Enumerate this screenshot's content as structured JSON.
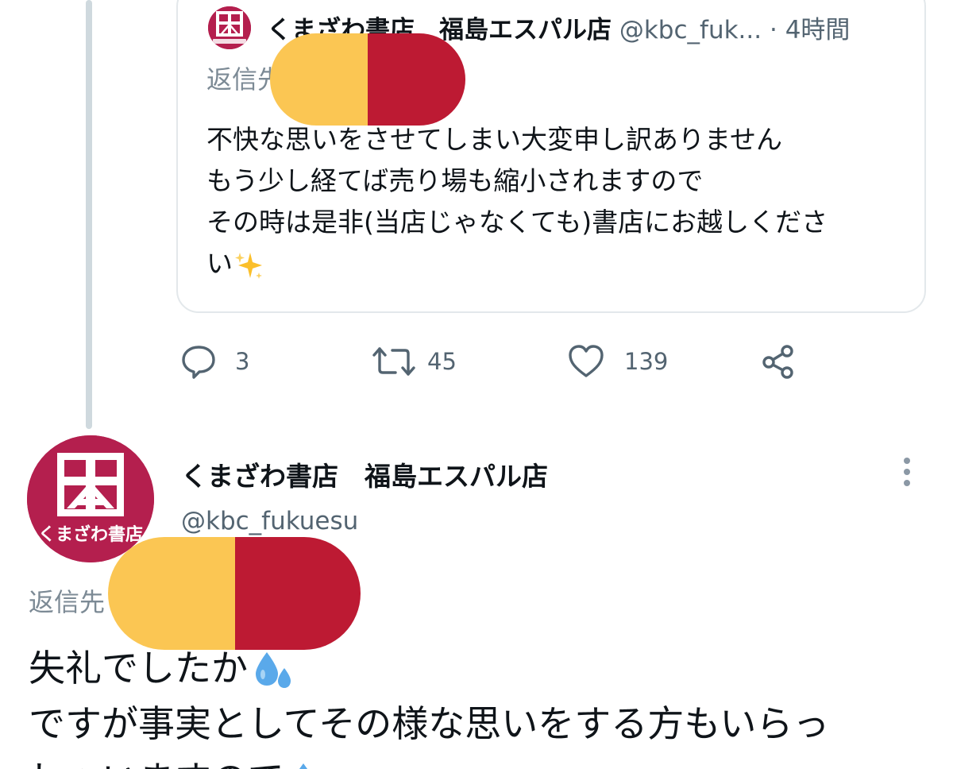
{
  "quoted_tweet": {
    "account_name": "くまざわ書店　福島エスパル店",
    "handle": "@kbc_fuk...",
    "separator": "·",
    "time": "4時間",
    "reply_prefix": "返信先",
    "body_lines": [
      "不快な思いをさせてしまい大変申し訳ありません",
      "もう少し経てば売り場も縮小されますので",
      "その時は是非(当店じゃなくても)書店にお越しくださ",
      "い"
    ],
    "trailing_emoji": "sparkles-emoji"
  },
  "actions": {
    "reply_count": "3",
    "retweet_count": "45",
    "like_count": "139"
  },
  "main_tweet": {
    "account_name": "くまざわ書店　福島エスパル店",
    "handle": "@kbc_fukuesu",
    "reply_prefix": "返信先",
    "avatar_text": "くまざわ書店",
    "body_lines": [
      "失礼でしたか",
      "ですが事実としてその様な思いをする方もいらっ",
      "しゃいますので"
    ],
    "emoji": "sweat-droplets-emoji"
  },
  "colors": {
    "brand": "#b41f4e",
    "redaction_yellow": "#fbc653",
    "redaction_red": "#bd1a33",
    "muted_text": "#536471",
    "emoji_blue": "#5aa9ea"
  }
}
